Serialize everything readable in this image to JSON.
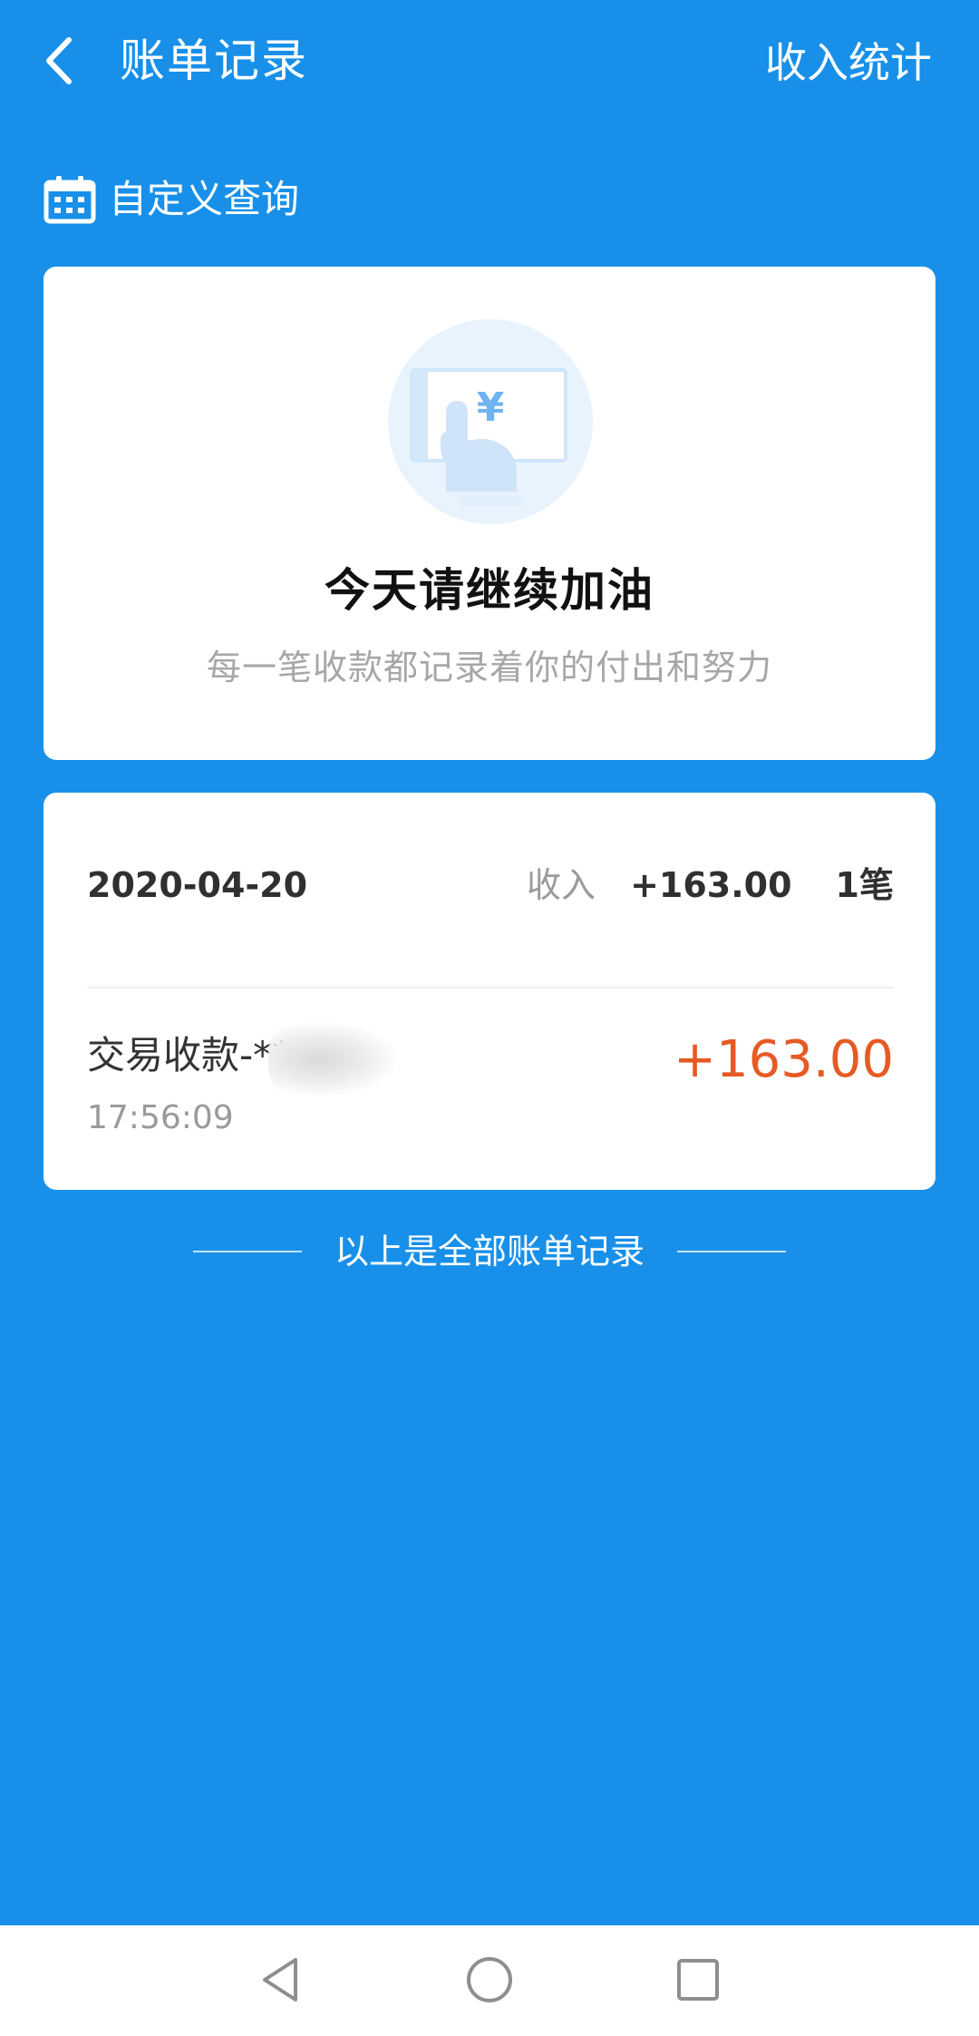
{
  "header": {
    "title": "账单记录",
    "right_action": "收入统计",
    "back_icon": "chevron-left-icon"
  },
  "filter": {
    "label": "自定义查询",
    "icon": "calendar-icon"
  },
  "motivation": {
    "title": "今天请继续加油",
    "subtitle": "每一笔收款都记录着你的付出和努力",
    "illustration_icon": "payment-terminal-icon",
    "currency_symbol": "¥"
  },
  "records": {
    "summary": {
      "date": "2020-04-20",
      "income_label": "收入",
      "amount": "+163.00",
      "count": "1笔"
    },
    "items": [
      {
        "title": "交易收款-**",
        "time": "17:56:09",
        "amount": "+163.00"
      }
    ]
  },
  "footer_note": "以上是全部账单记录",
  "nav": {
    "back_icon": "triangle-back-icon",
    "home_icon": "circle-home-icon",
    "recent_icon": "square-recent-icon"
  },
  "colors": {
    "background": "#1890E9",
    "card": "#FFFFFF",
    "amount_accent": "#E65A24",
    "muted_text": "#A7A7A7"
  }
}
